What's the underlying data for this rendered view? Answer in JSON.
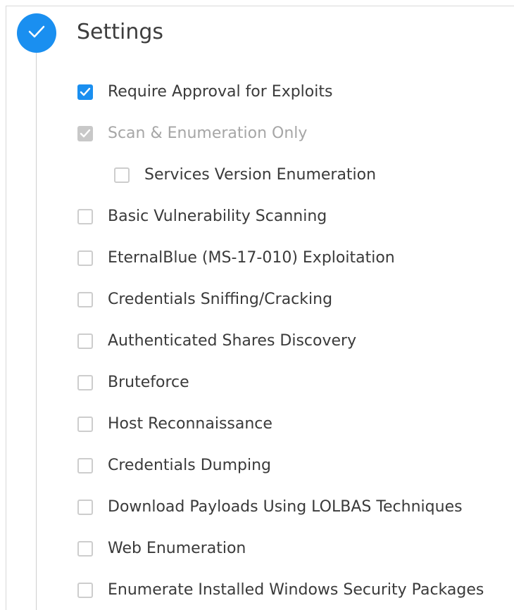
{
  "section": {
    "title": "Settings",
    "status_icon": "check-icon",
    "accent_color": "#1a8ff0"
  },
  "options": [
    {
      "label": "Require Approval for Exploits",
      "checked": true,
      "disabled": false
    },
    {
      "label": "Scan & Enumeration Only",
      "checked": true,
      "disabled": true
    },
    {
      "label": "Services Version Enumeration",
      "checked": false,
      "disabled": false,
      "nested": true
    },
    {
      "label": "Basic Vulnerability Scanning",
      "checked": false,
      "disabled": false
    },
    {
      "label": "EternalBlue (MS-17-010) Exploitation",
      "checked": false,
      "disabled": false
    },
    {
      "label": "Credentials Sniffing/Cracking",
      "checked": false,
      "disabled": false
    },
    {
      "label": "Authenticated Shares Discovery",
      "checked": false,
      "disabled": false
    },
    {
      "label": "Bruteforce",
      "checked": false,
      "disabled": false
    },
    {
      "label": "Host Reconnaissance",
      "checked": false,
      "disabled": false
    },
    {
      "label": "Credentials Dumping",
      "checked": false,
      "disabled": false
    },
    {
      "label": "Download Payloads Using LOLBAS Techniques",
      "checked": false,
      "disabled": false
    },
    {
      "label": "Web Enumeration",
      "checked": false,
      "disabled": false
    },
    {
      "label": "Enumerate Installed Windows Security Packages",
      "checked": false,
      "disabled": false
    }
  ]
}
